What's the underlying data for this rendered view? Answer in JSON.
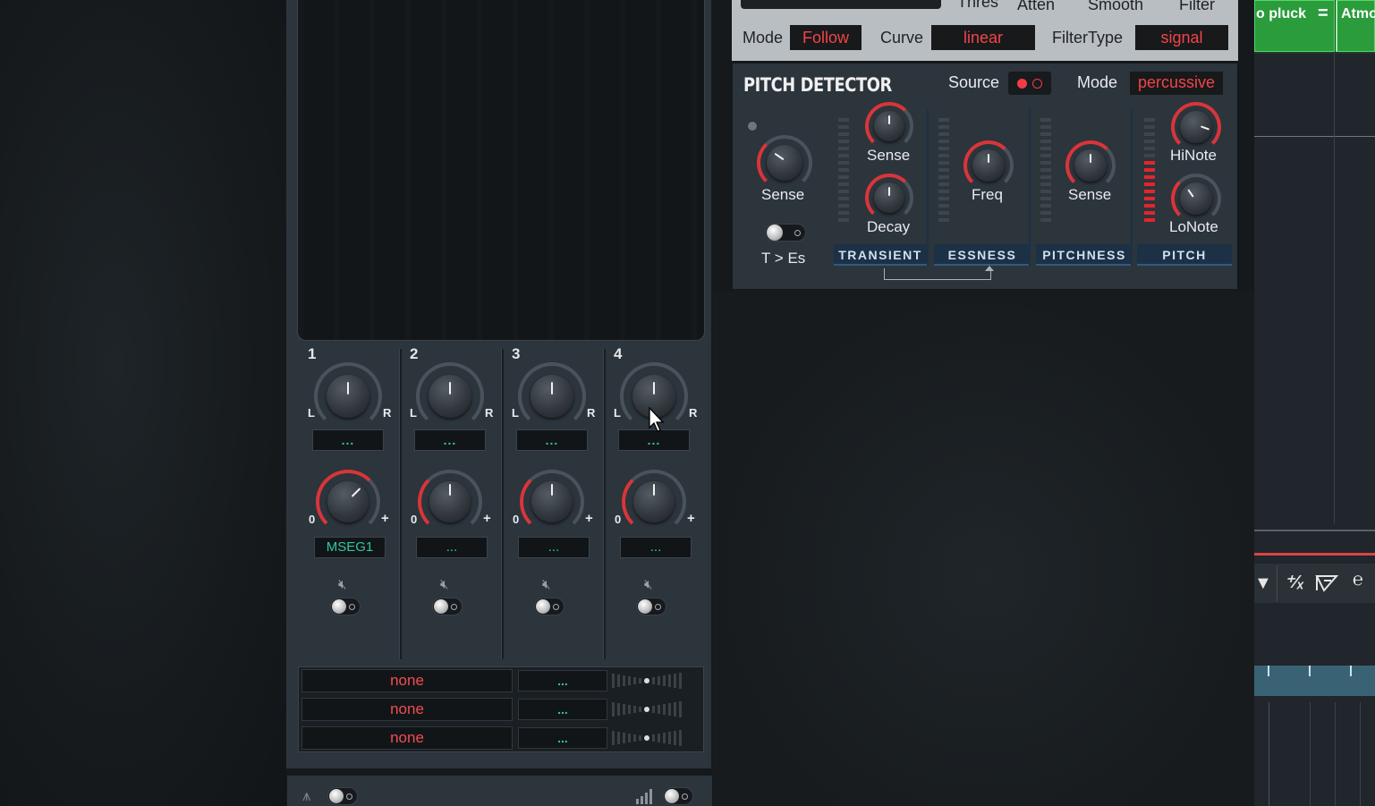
{
  "mixer": {
    "channels": [
      {
        "number": "1",
        "pan_left": "L",
        "pan_right": "R",
        "src": "...",
        "amt_min": "0",
        "amt_plus": "+",
        "mod": "MSEG1"
      },
      {
        "number": "2",
        "pan_left": "L",
        "pan_right": "R",
        "src": "...",
        "amt_min": "0",
        "amt_plus": "+",
        "mod": "..."
      },
      {
        "number": "3",
        "pan_left": "L",
        "pan_right": "R",
        "src": "...",
        "amt_min": "0",
        "amt_plus": "+",
        "mod": "..."
      },
      {
        "number": "4",
        "pan_left": "L",
        "pan_right": "R",
        "src": "...",
        "amt_min": "0",
        "amt_plus": "+",
        "mod": "..."
      }
    ],
    "mod_rows": [
      {
        "target": "none",
        "source": "..."
      },
      {
        "target": "none",
        "source": "..."
      },
      {
        "target": "none",
        "source": "..."
      }
    ]
  },
  "envelope_follower": {
    "top_labels": [
      "Thres",
      "Atten",
      "Smooth",
      "Filter"
    ],
    "mode_label": "Mode",
    "mode_value": "Follow",
    "curve_label": "Curve",
    "curve_value": "linear",
    "filtertype_label": "FilterType",
    "filtertype_value": "signal"
  },
  "pitch_detector": {
    "title": "PITCH DETECTOR",
    "source_label": "Source",
    "mode_label": "Mode",
    "mode_value": "percussive",
    "main_sense": "Sense",
    "t_es": "T > Es",
    "transient": {
      "title": "TRANSIENT",
      "knob1": "Sense",
      "knob2": "Decay"
    },
    "essness": {
      "title": "ESSNESS",
      "knob": "Freq"
    },
    "pitchness": {
      "title": "PITCHNESS",
      "knob": "Sense"
    },
    "pitch": {
      "title": "PITCH",
      "knob1": "HiNote",
      "knob2": "LoNote",
      "meter_level": 0.6
    }
  },
  "daw": {
    "clip1": "o pluck",
    "clip2": "Atmo",
    "menu_glyph": "="
  },
  "colors": {
    "accent_red": "#f24447",
    "accent_teal": "#2ec9a0",
    "section_blue": "#1c3146"
  }
}
